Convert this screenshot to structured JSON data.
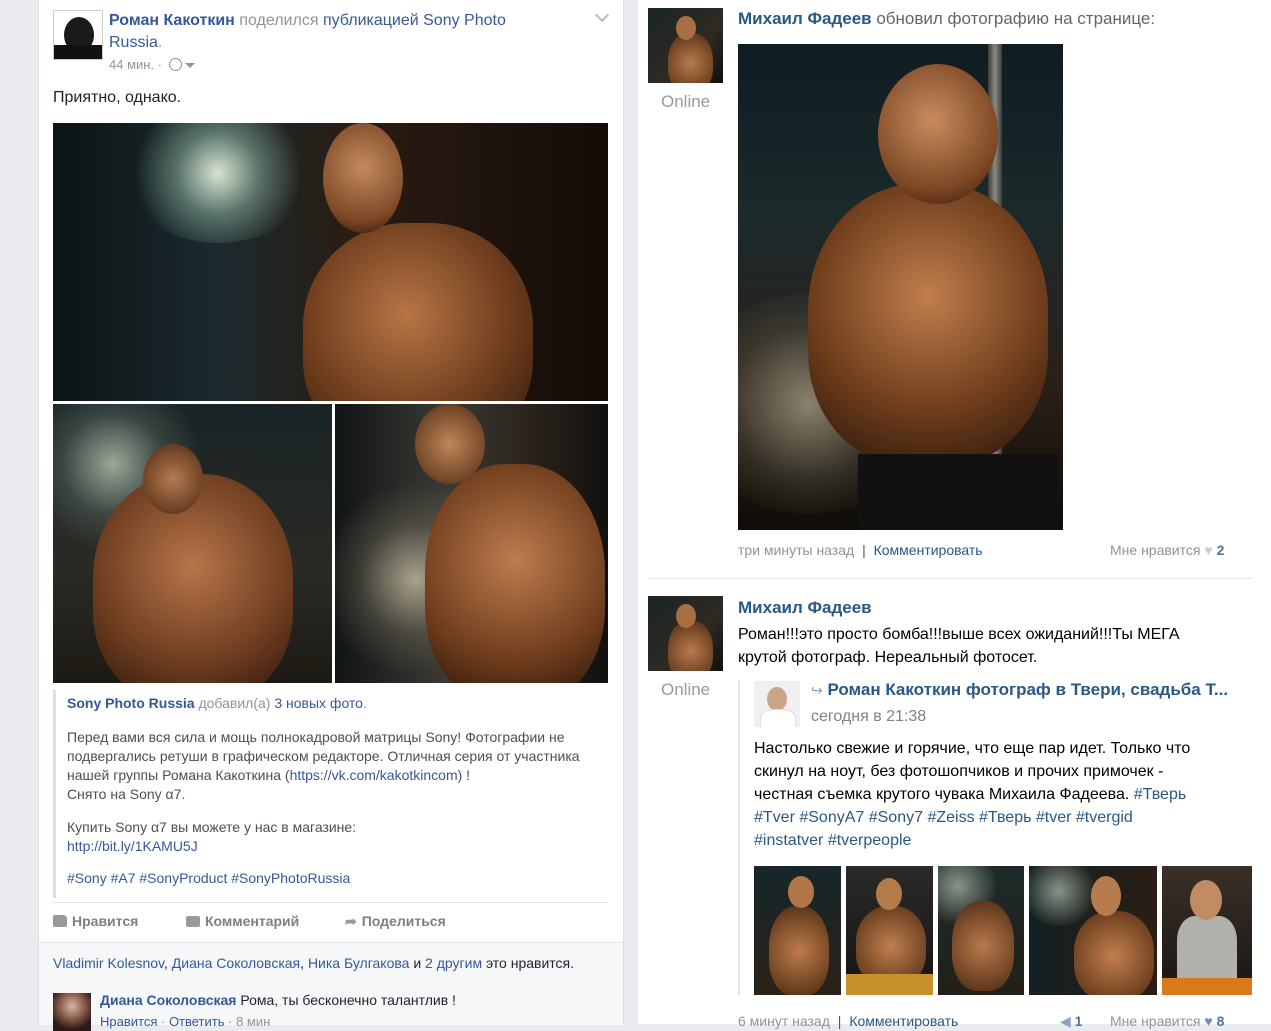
{
  "fb": {
    "author": "Роман Какоткин",
    "shared_text": "поделился",
    "shared_link": "публикацией Sony Photo Russia",
    "shared_end": ".",
    "time": "44 мин. ·",
    "post_text": "Приятно, однако.",
    "share_box": {
      "page": "Sony Photo Russia",
      "added": "добавил(а)",
      "count_link": "3 новых фото",
      "dot": ".",
      "desc_lines": [
        "Перед вами вся сила и мощь полнокадровой матрицы Sony! Фотографии не",
        "подвергались ретуши в графическом редакторе. Отличная серия от участника",
        "нашей группы Романа Какоткина (",
        "https://vk.com/kakotkincom",
        ") !",
        "Снято на Sony α7."
      ],
      "buy_text": "Купить Sony α7 вы можете у нас в магазине:",
      "buy_link": "http://bit.ly/1KAMU5J",
      "hashtags": "#Sony #A7 #SonyProduct #SonyPhotoRussia"
    },
    "actions": {
      "like": "Нравится",
      "comment": "Комментарий",
      "share": "Поделиться"
    },
    "likes": {
      "people": [
        "Vladimir Kolesnov",
        "Диана Соколовская",
        "Ника Булгакова"
      ],
      "sep1": ",",
      "sep2": ",",
      "and": "и",
      "others_link": "2 другим",
      "tail": "это нравится."
    },
    "comment": {
      "author": "Диана Соколовская",
      "text": "Рома, ты бесконечно талантлив !",
      "like": "Нравится",
      "reply": "Ответить",
      "time": "8 мин"
    }
  },
  "vk": {
    "post1": {
      "author": "Михаил Фадеев",
      "action": "обновил фотографию на странице:",
      "status": "Online",
      "time": "три минуты назад",
      "sep": "|",
      "comment": "Комментировать",
      "like_label": "Мне нравится",
      "like_count": "2"
    },
    "post2": {
      "author": "Михаил Фадеев",
      "text_l1": "Роман!!!это просто бомба!!!выше всех ожиданий!!!Ты МЕГА",
      "text_l2": "крутой фотограф. Нереальный фотосет.",
      "status": "Online",
      "repost": {
        "title": "Роман Какоткин фотограф в Твери, свадьба Т...",
        "time": "сегодня в 21:38",
        "text_l1": "Настолько свежие и горячие, что еще пар идет. Только что",
        "text_l2": "скинул на ноут, без фотошопчиков и прочих примочек -",
        "text_l3": "честная съемка крутого чувака Михаила Фадеева.",
        "tag_l3": "#Тверь",
        "tags_l4": "#Tver #SonyA7 #Sony7 #Zeiss #Тверь #tver #tvergid",
        "tags_l5": "#instatver #tverpeople"
      },
      "time": "6 минут назад",
      "sep": "|",
      "comment": "Комментировать",
      "share_count": "1",
      "like_label": "Мне нравится",
      "like_count": "8"
    }
  },
  "colors": {
    "fb_link": "#365899",
    "vk_link": "#2a5885",
    "grey": "#90949c"
  }
}
